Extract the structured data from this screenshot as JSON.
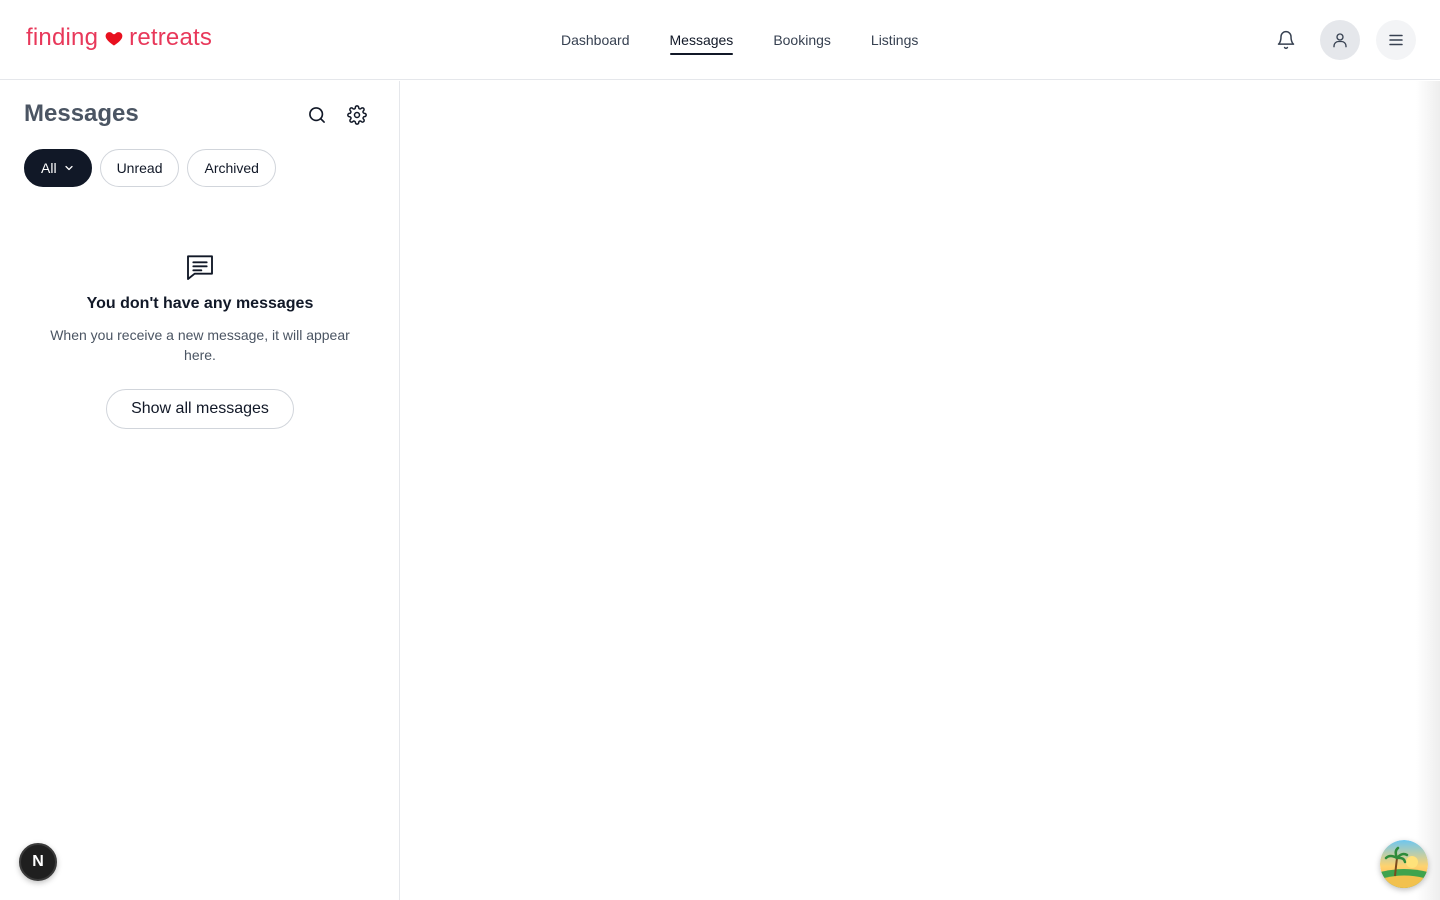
{
  "header": {
    "logo_left": "finding",
    "logo_right": "retreats",
    "nav": [
      {
        "label": "Dashboard",
        "active": false
      },
      {
        "label": "Messages",
        "active": true
      },
      {
        "label": "Bookings",
        "active": false
      },
      {
        "label": "Listings",
        "active": false
      }
    ],
    "icons": [
      "bell-icon",
      "user-icon",
      "menu-icon"
    ]
  },
  "sidebar": {
    "title": "Messages",
    "filters": [
      {
        "label": "All",
        "active": true,
        "has_dropdown": true
      },
      {
        "label": "Unread",
        "active": false
      },
      {
        "label": "Archived",
        "active": false
      }
    ],
    "empty_state": {
      "title": "You don't have any messages",
      "description": "When you receive a new message, it will appear here.",
      "button_label": "Show all messages"
    }
  },
  "badges": {
    "dev_badge_letter": "N"
  },
  "colors": {
    "brand": "#e8385a",
    "active_chip": "#111827",
    "border": "#e5e7eb"
  }
}
